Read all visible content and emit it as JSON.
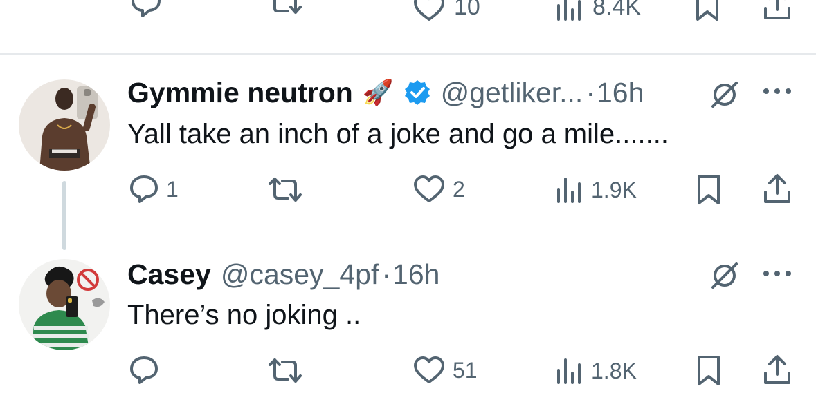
{
  "top_actions": {
    "likes": "10",
    "views": "8.4K"
  },
  "tweets": [
    {
      "name": "Gymmie neutron",
      "name_emoji": "🚀",
      "verified": true,
      "handle": "@getliker...",
      "separator": "·",
      "time": "16h",
      "text": "Yall take an inch of a joke and go a mile.......",
      "replies": "1",
      "retweets": "",
      "likes": "2",
      "views": "1.9K"
    },
    {
      "name": "Casey",
      "verified": false,
      "handle": "@casey_4pf",
      "separator": "·",
      "time": "16h",
      "text": "There’s no joking ..",
      "replies": "",
      "retweets": "",
      "likes": "51",
      "views": "1.8K"
    }
  ],
  "colors": {
    "text": "#0f1419",
    "secondary": "#536471",
    "verified": "#1d9bf0",
    "divider": "#e6e9ec"
  },
  "icons": [
    "reply-icon",
    "retweet-icon",
    "like-icon",
    "views-icon",
    "bookmark-icon",
    "share-icon",
    "grok-icon",
    "more-icon",
    "verified-badge-icon"
  ]
}
